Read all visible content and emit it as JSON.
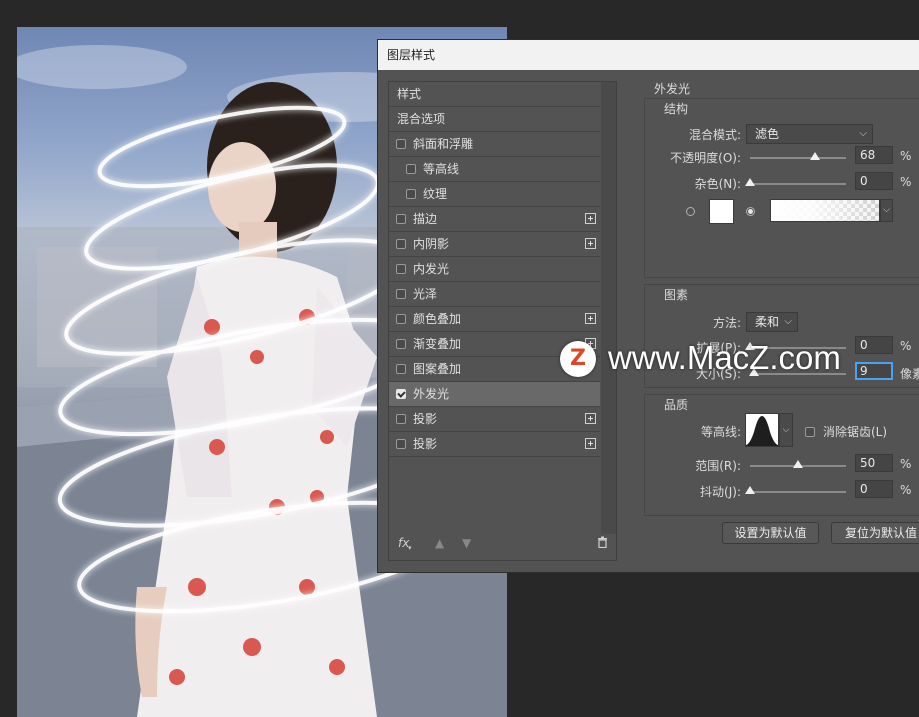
{
  "dialog": {
    "title": "图层样式"
  },
  "stylelist": {
    "items": [
      {
        "label": "样式",
        "type": "header"
      },
      {
        "label": "混合选项",
        "type": "header"
      },
      {
        "label": "斜面和浮雕",
        "checked": false,
        "indent": false,
        "plus": false
      },
      {
        "label": "等高线",
        "checked": false,
        "indent": true,
        "plus": false
      },
      {
        "label": "纹理",
        "checked": false,
        "indent": true,
        "plus": false
      },
      {
        "label": "描边",
        "checked": false,
        "indent": false,
        "plus": true
      },
      {
        "label": "内阴影",
        "checked": false,
        "indent": false,
        "plus": true
      },
      {
        "label": "内发光",
        "checked": false,
        "indent": false,
        "plus": false
      },
      {
        "label": "光泽",
        "checked": false,
        "indent": false,
        "plus": false
      },
      {
        "label": "颜色叠加",
        "checked": false,
        "indent": false,
        "plus": true
      },
      {
        "label": "渐变叠加",
        "checked": false,
        "indent": false,
        "plus": true
      },
      {
        "label": "图案叠加",
        "checked": false,
        "indent": false,
        "plus": false
      },
      {
        "label": "外发光",
        "checked": true,
        "indent": false,
        "plus": false,
        "selected": true
      },
      {
        "label": "投影",
        "checked": false,
        "indent": false,
        "plus": true
      },
      {
        "label": "投影",
        "checked": false,
        "indent": false,
        "plus": true
      }
    ],
    "footer": {
      "fx": "fx",
      "up_icon": "arrow-up-icon",
      "down_icon": "arrow-down-icon",
      "trash_icon": "trash-icon"
    }
  },
  "outer_glow": {
    "section_title": "外发光",
    "structure": {
      "title": "结构",
      "blend_mode_label": "混合模式:",
      "blend_mode_value": "滤色",
      "opacity_label": "不透明度(O):",
      "opacity_value": "68",
      "opacity_unit": "%",
      "opacity_level": 0.68,
      "noise_label": "杂色(N):",
      "noise_value": "0",
      "noise_unit": "%",
      "noise_level": 0
    },
    "elements": {
      "title": "图素",
      "method_label": "方法:",
      "method_value": "柔和",
      "spread_label": "扩展(P):",
      "spread_value": "0",
      "spread_unit": "%",
      "spread_level": 0,
      "size_label": "大小(S):",
      "size_value": "9",
      "size_unit": "像素",
      "size_level": 0.04
    },
    "quality": {
      "title": "品质",
      "contour_label": "等高线:",
      "antialias_label": "消除锯齿(L)",
      "range_label": "范围(R):",
      "range_value": "50",
      "range_unit": "%",
      "range_level": 0.5,
      "jitter_label": "抖动(J):",
      "jitter_value": "0",
      "jitter_unit": "%",
      "jitter_level": 0
    },
    "buttons": {
      "set_default": "设置为默认值",
      "reset_default": "复位为默认值"
    }
  },
  "watermark": {
    "logo_letter": "Z",
    "text": "www.MacZ.com"
  },
  "colors": {
    "dialog_bg": "#535353",
    "accent_focus": "#4aa3f0",
    "watermark_logo": "#e0452b"
  }
}
